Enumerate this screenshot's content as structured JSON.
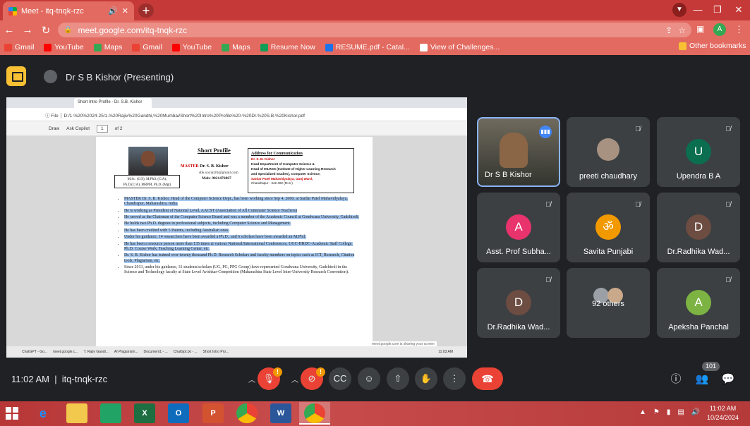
{
  "browser": {
    "tab_title": "Meet - itq-tnqk-rzc",
    "url": "meet.google.com/itq-tnqk-rzc",
    "profile_initial": "A",
    "bookmarks": [
      {
        "label": "Gmail",
        "color": "#ea4335"
      },
      {
        "label": "YouTube",
        "color": "#ff0000"
      },
      {
        "label": "Maps",
        "color": "#34a853"
      },
      {
        "label": "Gmail",
        "color": "#ea4335"
      },
      {
        "label": "YouTube",
        "color": "#ff0000"
      },
      {
        "label": "Maps",
        "color": "#34a853"
      },
      {
        "label": "Resume Now",
        "color": "#0f9d58"
      },
      {
        "label": "RESUME.pdf - Catal...",
        "color": "#1a73e8"
      },
      {
        "label": "View of Challenges...",
        "color": "#ffffff"
      }
    ],
    "other_bookmarks": "Other bookmarks"
  },
  "meet": {
    "presenter": "Dr S B Kishor (Presenting)",
    "time": "11:02 AM",
    "code": "itq-tnqk-rzc",
    "participant_count": "101",
    "participants": [
      {
        "name": "Dr S B Kishor",
        "initial": "",
        "color": ""
      },
      {
        "name": "preeti chaudhary",
        "initial": "",
        "color": ""
      },
      {
        "name": "Upendra B A",
        "initial": "U",
        "color": "#0b6e4f"
      },
      {
        "name": "Asst. Prof Subha...",
        "initial": "A",
        "color": "#e8336d"
      },
      {
        "name": "Savita Punjabi",
        "initial": "ॐ",
        "color": "#f29900"
      },
      {
        "name": "Dr.Radhika Wad...",
        "initial": "D",
        "color": "#6d4c41"
      },
      {
        "name": "Dr.Radhika Wad...",
        "initial": "D",
        "color": "#6d4c41"
      },
      {
        "name": "92 others",
        "initial": "",
        "color": ""
      },
      {
        "name": "Apeksha Panchal",
        "initial": "A",
        "color": "#7cb342"
      }
    ]
  },
  "shared": {
    "tab_title": "Short Intro Profile - Dr. S.B. Kishor",
    "file_path": "D:/1.%20%2024-25/1.%20Rajiv%20Gandhi,%20Mumbai/Short%20Intro%20Profile%20-%20Dr.%20S.B.%20Kishor.pdf",
    "pdf_draw": "Draw",
    "pdf_copilot": "Ask Copilot",
    "pdf_page": "1",
    "pdf_of": "of 2",
    "profile_title": "Short Profile",
    "name_prefix": "MASTER",
    "name": "Dr. S. B. Kishor",
    "email": "sbk.social20@gmail.com",
    "mob": "Mob: 9021476867",
    "quals_1": "M.Sc. (C/S), M.Phil. (C/A),",
    "quals_2": "Ph.D.(C/A), MRPM, Ph.D. (Mgt)",
    "addr_heading": "Address for Communication",
    "addr_lines": [
      "Dr. S. B. Kishor",
      "Head Department of Computer Science &",
      "Head of IHLRSS (Institute of Higher Learning Research",
      "and Specialized Studies), Computer Science,",
      "Sardar Patel Mahavidyalaya, Ganj Ward,",
      "Chandrapur - 442 402 (M.S.)"
    ],
    "bullets": [
      "MASTER Dr. S. B. Kishor, Head of the Computer Science Dept., has been working since Sep 4, 2000, at Sardar Patel Mahavidyalaya, Chandrapur, Maharashtra, India.",
      "He is working as President of National Level, AACST (Association of All Commuter Science Teachers)",
      "He served as the Chairman of the Computer Science Board and was a member of the Academic Council at Gondwana University, Gadchiroli.",
      "He holds two Ph.D. degrees in professional subjects, including Computer Science and Management.",
      "He has been credited with 5 Patents, including Australian ones.",
      "Under his guidance, 14 researchers have been awarded a Ph.D., and 6 scholars have been awarded an M.Phil.",
      "He has been a resource person more than 135 times at various National/International Conferences, UGC-HRDC-Academic Staff College, Ph.D. Course Work, Teaching Learning Center, etc.",
      "Dr. S. B. Kishor has trained over twenty thousand Ph.D. Research Scholars and faculty members on topics such as ICT, Research, Citation tools, Plagiarism, etc.",
      "Since 2013, under his guidance, 31 students/scholars (UG, PG, PPG Group) have represented Gondwana University, Gadchiroli in the Science and Technology faculty at State Level Avishkar-Competition (Maharashtra State Level Inter-University Research Convention)."
    ],
    "taskbar_items": [
      "ChatGPT - Go...",
      "meet.google.c...",
      "T. Rajiv Gandi...",
      "AI Plagiarism...",
      "Document1 - ...",
      "ChatGpt.txt - ...",
      "Short Intro Pro..."
    ],
    "notice": "meet.google.com is sharing your screen",
    "taskbar_time": "11:03 AM"
  },
  "taskbar": {
    "time": "11:02 AM",
    "date": "10/24/2024",
    "alert": "!"
  }
}
